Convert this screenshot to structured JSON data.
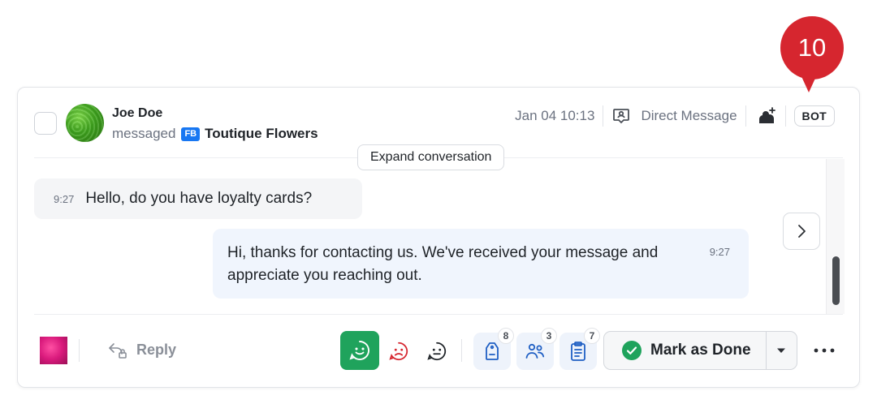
{
  "callout": {
    "number": "10"
  },
  "conversation": {
    "contact_name": "Joe Doe",
    "action_text": "messaged",
    "channel_badge": "FB",
    "page_name": "Toutique Flowers",
    "timestamp": "Jan 04 10:13",
    "channel_type": "Direct Message",
    "bot_label": "BOT",
    "expand_label": "Expand conversation"
  },
  "messages": [
    {
      "direction": "incoming",
      "time": "9:27",
      "text": "Hello, do you have loyalty cards?"
    },
    {
      "direction": "outgoing",
      "time": "9:27",
      "text": "Hi, thanks for contacting us. We've received your message and appreciate you reaching out."
    }
  ],
  "footer": {
    "reply_label": "Reply",
    "sentiment": [
      {
        "name": "positive",
        "selected": true,
        "color": "#1fa35c"
      },
      {
        "name": "negative",
        "selected": false,
        "color": "#d6262f"
      },
      {
        "name": "neutral",
        "selected": false,
        "color": "#1f2328"
      }
    ],
    "tags_count": "8",
    "assignees_count": "3",
    "notes_count": "7",
    "mark_done_label": "Mark as Done"
  },
  "colors": {
    "accent_green": "#1fa35c",
    "callout_red": "#d6262f",
    "facebook_blue": "#1877f2",
    "outgoing_bubble": "#f0f5fd"
  }
}
